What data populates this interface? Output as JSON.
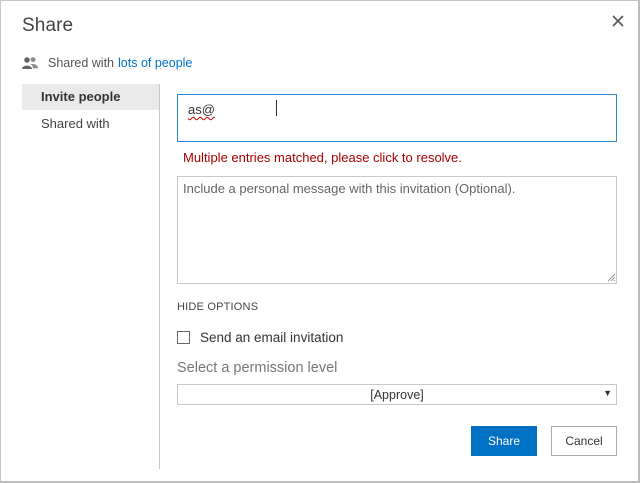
{
  "dialog": {
    "title": "Share",
    "close_icon": "close-icon"
  },
  "shared_with": {
    "prefix": "Shared with",
    "link": "lots of people",
    "icon": "people-icon"
  },
  "nav": {
    "items": [
      {
        "label": "Invite people",
        "active": true
      },
      {
        "label": "Shared with",
        "active": false
      }
    ]
  },
  "invite": {
    "value": "as@",
    "error": "Multiple entries matched, please click to resolve."
  },
  "message": {
    "placeholder": "Include a personal message with this invitation (Optional).",
    "value": ""
  },
  "options": {
    "toggle_label": "HIDE OPTIONS",
    "email_invitation_label": "Send an email invitation",
    "email_invitation_checked": false,
    "permission_label": "Select a permission level",
    "permission_value": "[Approve]"
  },
  "buttons": {
    "share": "Share",
    "cancel": "Cancel"
  },
  "colors": {
    "accent": "#0072c6",
    "error": "#a80000",
    "focus_border": "#2b88d8"
  }
}
